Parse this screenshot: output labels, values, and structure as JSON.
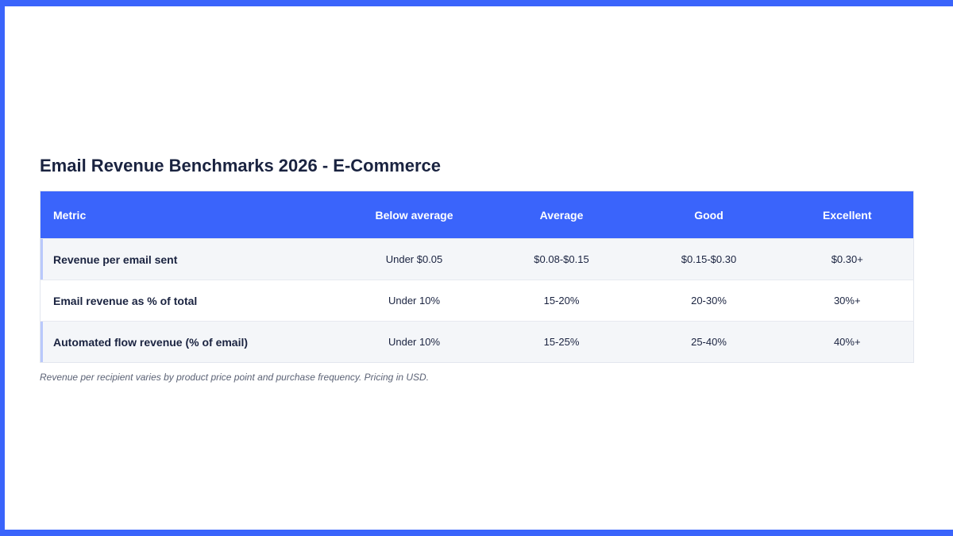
{
  "title": "Email Revenue Benchmarks 2026 - E-Commerce",
  "table": {
    "headers": [
      "Metric",
      "Below average",
      "Average",
      "Good",
      "Excellent"
    ],
    "rows": [
      [
        "Revenue per email sent",
        "Under $0.05",
        "$0.08-$0.15",
        "$0.15-$0.30",
        "$0.30+"
      ],
      [
        "Email revenue as % of total",
        "Under 10%",
        "15-20%",
        "20-30%",
        "30%+"
      ],
      [
        "Automated flow revenue (% of email)",
        "Under 10%",
        "15-25%",
        "25-40%",
        "40%+"
      ]
    ]
  },
  "footnote": "Revenue per recipient varies by product price point and purchase frequency. Pricing in USD.",
  "colors": {
    "accent": "#3a64fb",
    "row_alt": "#f4f6f9",
    "text": "#1a2340"
  }
}
